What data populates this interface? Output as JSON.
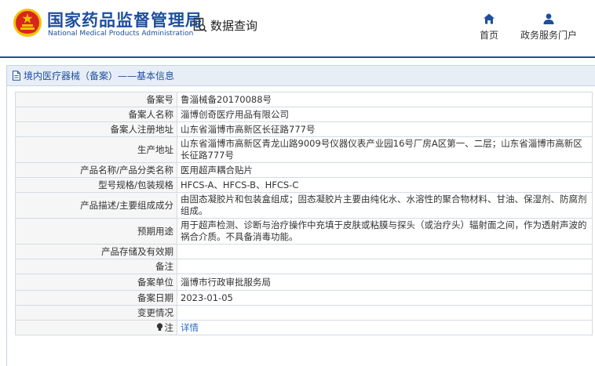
{
  "header": {
    "org_name_cn": "国家药品监督管理局",
    "org_name_en": "National Medical Products Administration",
    "query_label": "数据查询",
    "nav": [
      {
        "label": "首页",
        "icon": "home-icon"
      },
      {
        "label": "政务服务门户",
        "icon": "user-icon"
      }
    ]
  },
  "panel": {
    "title": "境内医疗器械（备案）——基本信息",
    "rows": [
      {
        "label": "备案号",
        "value": "鲁淄械备20170088号"
      },
      {
        "label": "备案人名称",
        "value": "淄博创奇医疗用品有限公司"
      },
      {
        "label": "备案人注册地址",
        "value": "山东省淄博市高新区长征路777号"
      },
      {
        "label": "生产地址",
        "value": "山东省淄博市高新区青龙山路9009号仪器仪表产业园16号厂房A区第一、二层；山东省淄博市高新区长征路777号"
      },
      {
        "label": "产品名称/产品分类名称",
        "value": "医用超声耦合贴片"
      },
      {
        "label": "型号规格/包装规格",
        "value": "HFCS-A、HFCS-B、HFCS-C"
      },
      {
        "label": "产品描述/主要组成成分",
        "value": "由固态凝胶片和包装盒组成；固态凝胶片主要由纯化水、水溶性的聚合物材料、甘油、保湿剂、防腐剂组成。"
      },
      {
        "label": "预期用途",
        "value": "用于超声检测、诊断与治疗操作中充填于皮肤或粘膜与探头（或治疗头）辐射面之间，作为透射声波的祸合介质。不具备消毒功能。"
      },
      {
        "label": "产品存储及有效期",
        "value": ""
      },
      {
        "label": "备注",
        "value": ""
      },
      {
        "label": "备案单位",
        "value": "淄博市行政审批服务局"
      },
      {
        "label": "备案日期",
        "value": "2023-01-05"
      },
      {
        "label": "变更情况",
        "value": ""
      },
      {
        "label": "注",
        "value": "详情"
      }
    ]
  },
  "colors": {
    "brand_blue": "#1e4f9c",
    "emblem_red": "#d7261e",
    "emblem_gold": "#f2c200",
    "link_blue": "#2a6ac8"
  }
}
